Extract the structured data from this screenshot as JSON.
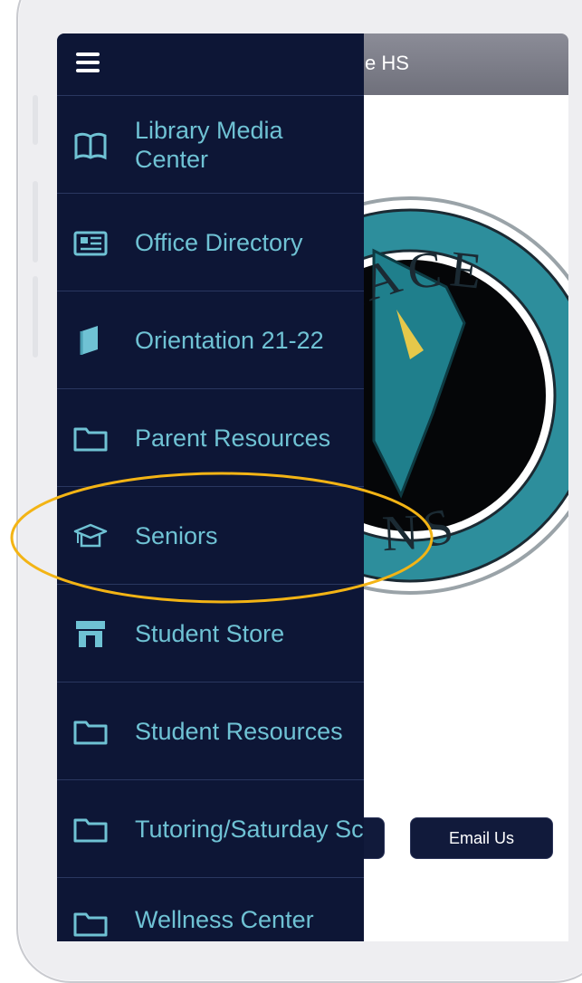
{
  "app": {
    "title": "e HS"
  },
  "drawer": {
    "items": [
      {
        "label": "Library Media Center",
        "icon": "book-open-icon"
      },
      {
        "label": "Office Directory",
        "icon": "newspaper-icon"
      },
      {
        "label": "Orientation 21-22",
        "icon": "book-icon"
      },
      {
        "label": "Parent Resources",
        "icon": "folder-icon"
      },
      {
        "label": "Seniors",
        "icon": "graduation-cap-icon"
      },
      {
        "label": "Student Store",
        "icon": "store-icon"
      },
      {
        "label": "Student Resources",
        "icon": "folder-icon"
      },
      {
        "label": "Tutoring/Saturday School",
        "icon": "folder-icon"
      },
      {
        "label": "Wellness Center",
        "icon": "folder-icon"
      }
    ]
  },
  "screen": {
    "email_button": "Email Us",
    "logo_text_top": "RRACE",
    "logo_text_bottom": "NS"
  },
  "colors": {
    "drawer_bg": "#0d1636",
    "menu_text": "#6fc2d4",
    "highlight": "#f3b415",
    "appbar": "#7d7e89"
  }
}
